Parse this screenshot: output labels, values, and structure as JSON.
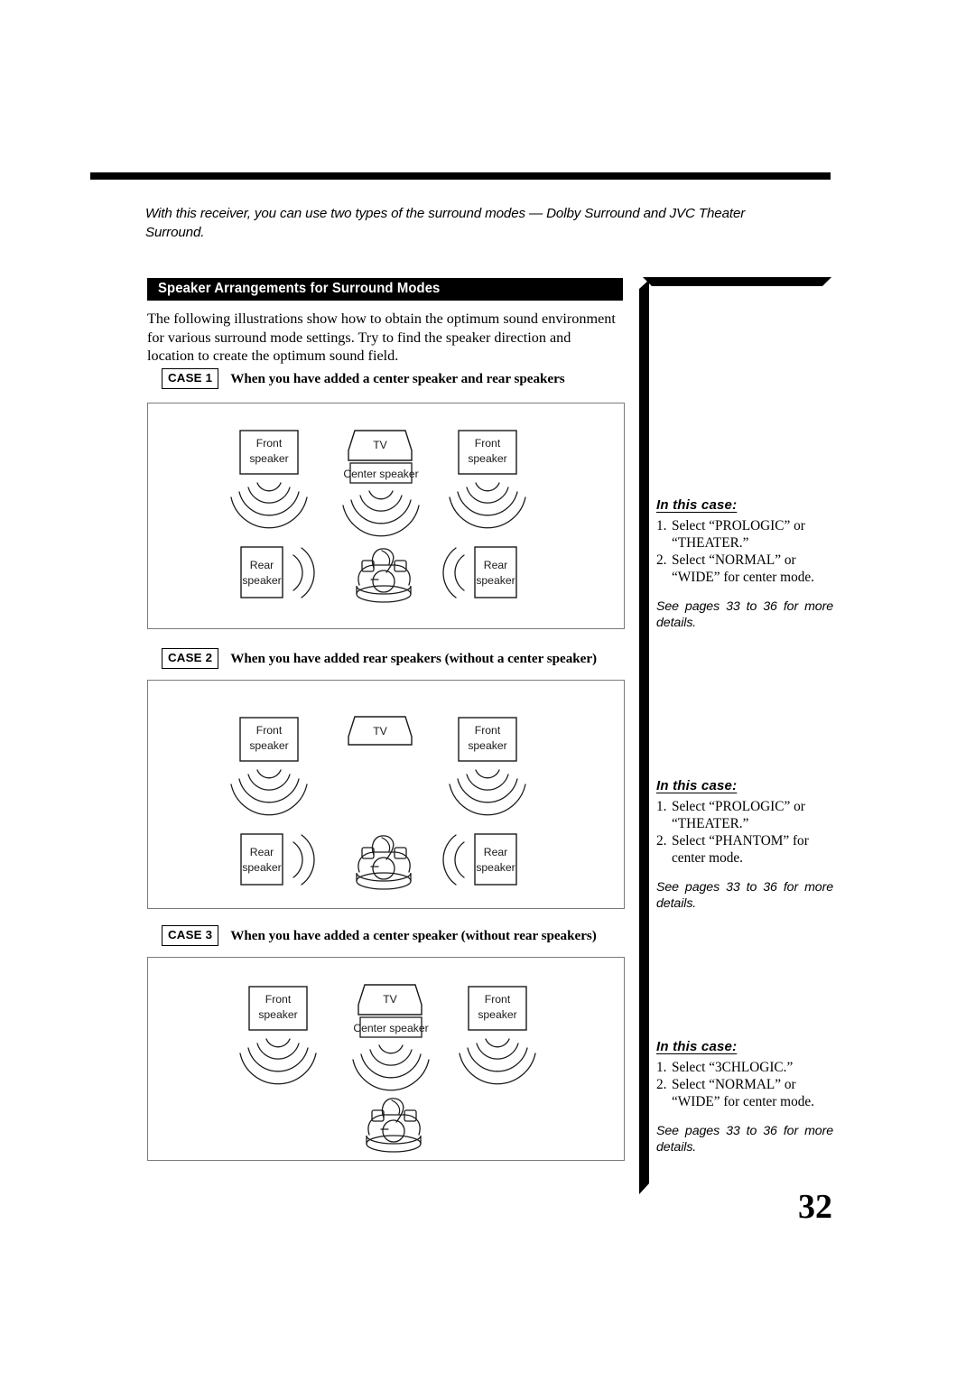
{
  "page": {
    "number": "32",
    "intro": "With this receiver, you can use two types of the surround modes — Dolby Surround and JVC Theater Surround.",
    "section_title": "Speaker Arrangements for Surround Modes",
    "lead_paragraph": "The following illustrations show how to obtain the optimum sound environment for various surround mode settings. Try to find the speaker direction and location to create the optimum sound field."
  },
  "labels": {
    "front_speaker_line1": "Front",
    "front_speaker_line2": "speaker",
    "rear_speaker_line1": "Rear",
    "rear_speaker_line2": "speaker",
    "tv": "TV",
    "center_speaker": "Center speaker"
  },
  "cases": [
    {
      "tag": "CASE 1",
      "title": "When you have added a center speaker and rear speakers",
      "note_heading": "In this case:",
      "items": [
        {
          "num": "1.",
          "text": "Select “PROLOGIC” or “THEATER.”"
        },
        {
          "num": "2.",
          "text": "Select “NORMAL” or “WIDE” for center mode."
        }
      ],
      "see_also": "See pages 33 to 36 for more details."
    },
    {
      "tag": "CASE 2",
      "title": "When you have added rear speakers (without a center speaker)",
      "note_heading": "In this case:",
      "items": [
        {
          "num": "1.",
          "text": "Select “PROLOGIC” or “THEATER.”"
        },
        {
          "num": "2.",
          "text": "Select “PHANTOM” for center mode."
        }
      ],
      "see_also": "See pages 33 to 36 for more details."
    },
    {
      "tag": "CASE 3",
      "title": "When you have added a center speaker (without rear speakers)",
      "note_heading": "In this case:",
      "items": [
        {
          "num": "1.",
          "text": "Select “3CHLOGIC.”"
        },
        {
          "num": "2.",
          "text": "Select “NORMAL” or “WIDE” for center mode."
        }
      ],
      "see_also": "See pages 33 to 36 for more details."
    }
  ],
  "colors": {
    "ink": "#000000",
    "diagram_border": "#7a7a7a",
    "diagram_line": "#1a1a1a"
  }
}
